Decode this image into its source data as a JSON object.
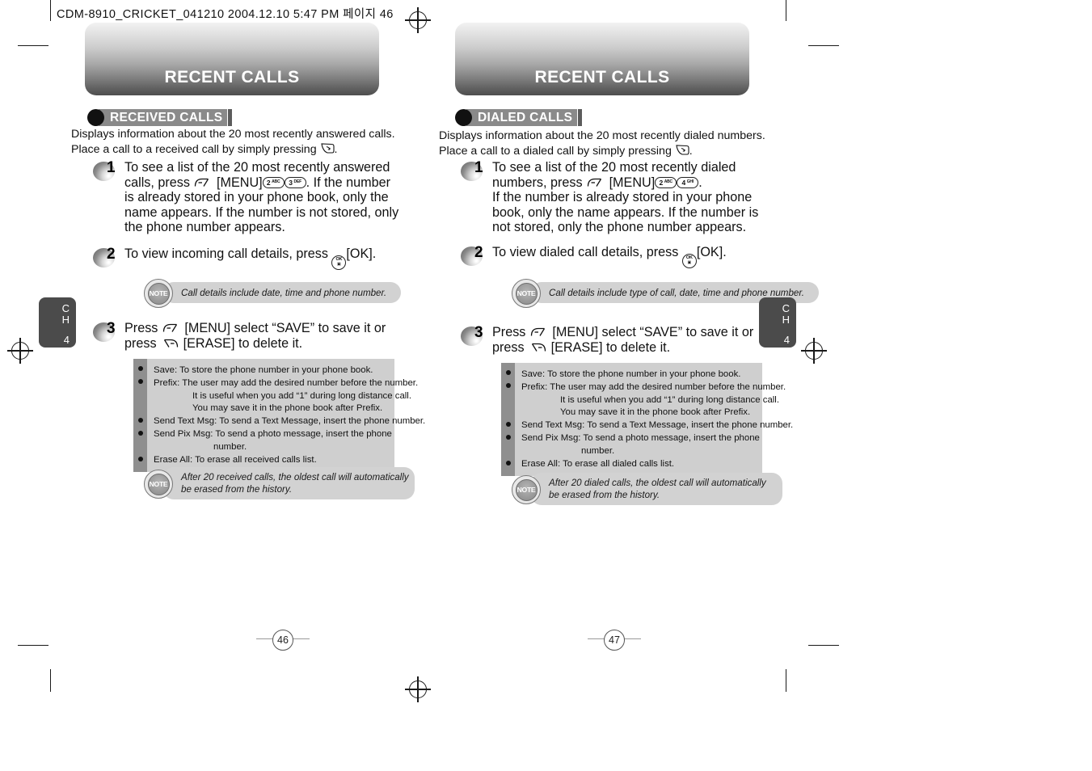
{
  "file_header": "CDM-8910_CRICKET_041210  2004.12.10 5:47 PM  페이지 46",
  "pages": [
    {
      "banner_title": "RECENT CALLS",
      "section_label": "RECEIVED CALLS",
      "intro_lines": [
        "Displays information about the 20 most recently answered calls.",
        "Place a call to a received call by simply pressing"
      ],
      "intro_trailing": ".",
      "steps": [
        {
          "number": "1",
          "lines": [
            "To see a list of the 20 most recently answered",
            "calls, press ⟨MENU-key⟩ [MENU] ⟨key 2 ABC⟩⟨key 3 DEF⟩. If the number",
            "is already stored in your phone book, only the",
            "name appears. If the number is not stored, only",
            "the phone number appears."
          ]
        },
        {
          "number": "2",
          "lines": [
            "To view incoming call details, press ⟨OK-key⟩ [OK]."
          ]
        },
        {
          "number": "3",
          "lines": [
            "Press ⟨MENU-key⟩ [MENU] select “SAVE” to save it or",
            "press ⟨ERASE-key⟩ [ERASE] to delete it."
          ]
        }
      ],
      "step1_text_a": "To see a list of the 20 most recently answered",
      "step1_text_b1": "calls, press",
      "step1_text_b2": "[MENU]",
      "step1_text_b3": ". If the number",
      "step1_text_c": "is already stored in your phone book, only the",
      "step1_text_d": "name appears. If the number is not stored, only",
      "step1_text_e": "the phone number appears.",
      "step1_keys": [
        {
          "digit": "2",
          "letters": "ABC"
        },
        {
          "digit": "3",
          "letters": "DEF"
        }
      ],
      "step2_text_a": "To view incoming call details, press",
      "step2_text_b": "[OK].",
      "step3_text_a1": "Press",
      "step3_text_a2": "[MENU] select “SAVE” to save it or",
      "step3_text_b1": "press",
      "step3_text_b2": "[ERASE] to delete it.",
      "note_top": "Call details include date, time and phone number.",
      "note_bottom_lines": [
        "After 20 received calls, the oldest call will automatically",
        "be erased from the history."
      ],
      "infobox_lines": [
        {
          "text": "Save: To store the phone number in your phone book.",
          "indent": 0,
          "bullet": true
        },
        {
          "text": "Prefix: The user may add the desired number before the number.",
          "indent": 0,
          "bullet": true
        },
        {
          "text": "It is useful when you add “1” during long distance call.",
          "indent": 1,
          "bullet": false
        },
        {
          "text": "You may save it in the phone book after Prefix.",
          "indent": 1,
          "bullet": false
        },
        {
          "text": "Send Text Msg: To send a Text Message, insert the phone number.",
          "indent": 0,
          "bullet": true
        },
        {
          "text": "Send Pix Msg: To send a photo message, insert the phone",
          "indent": 0,
          "bullet": true
        },
        {
          "text": "number.",
          "indent": 2,
          "bullet": false
        },
        {
          "text": "Erase All: To erase all received calls list.",
          "indent": 0,
          "bullet": true
        }
      ],
      "chapter": {
        "label_c": "C",
        "label_h": "H",
        "number": "4"
      },
      "page_number": "46"
    },
    {
      "banner_title": "RECENT CALLS",
      "section_label": "DIALED CALLS",
      "intro_lines": [
        "Displays information about the 20 most recently dialed numbers.",
        "Place a call to a dialed call by simply pressing"
      ],
      "intro_trailing": ".",
      "step1_text_a": "To see a list of the 20 most recently dialed",
      "step1_text_b1": "numbers, press",
      "step1_text_b2": "[MENU]",
      "step1_text_b3": ".",
      "step1_text_c": "If the number is already stored in your phone",
      "step1_text_d": "book, only the name appears. If the number is",
      "step1_text_e": "not stored, only the phone number appears.",
      "step1_keys": [
        {
          "digit": "2",
          "letters": "ABC"
        },
        {
          "digit": "4",
          "letters": "GHI"
        }
      ],
      "step2_text_a": "To view dialed call details, press",
      "step2_text_b": "[OK].",
      "step3_text_a1": "Press",
      "step3_text_a2": "[MENU] select “SAVE” to save it or",
      "step3_text_b1": "press",
      "step3_text_b2": "[ERASE] to delete it.",
      "note_top": "Call details include type of call, date, time and phone number.",
      "note_bottom_lines": [
        "After 20 dialed calls, the oldest call will automatically",
        "be erased from the history."
      ],
      "infobox_lines": [
        {
          "text": "Save: To store the phone number in your phone book.",
          "indent": 0,
          "bullet": true
        },
        {
          "text": "Prefix: The user may add the desired number before the number.",
          "indent": 0,
          "bullet": true
        },
        {
          "text": "It is useful when you add “1” during long distance call.",
          "indent": 1,
          "bullet": false
        },
        {
          "text": "You may save it in the phone book after Prefix.",
          "indent": 1,
          "bullet": false
        },
        {
          "text": "Send Text Msg: To send a Text Message, insert the phone number.",
          "indent": 0,
          "bullet": true
        },
        {
          "text": "Send Pix Msg: To send a photo message, insert the phone",
          "indent": 0,
          "bullet": true
        },
        {
          "text": "number.",
          "indent": 2,
          "bullet": false
        },
        {
          "text": "Erase All: To erase all dialed calls list.",
          "indent": 0,
          "bullet": true
        }
      ],
      "chapter": {
        "label_c": "C",
        "label_h": "H",
        "number": "4"
      },
      "page_number": "47"
    }
  ],
  "step_numbers": {
    "one": "1",
    "two": "2",
    "three": "3"
  },
  "note_badge_text": "NOTE",
  "ok_key": {
    "top": "OK",
    "bottom": "▣"
  },
  "colors": {
    "banner_dark": "#4e4e4e",
    "section_chip": "#8a8a8a",
    "infobox_bg": "#cfcfcf",
    "infobox_gutter": "#8f8f8f",
    "note_bar": "#d2d2d2",
    "chapter_tab": "#4b4b4b"
  }
}
